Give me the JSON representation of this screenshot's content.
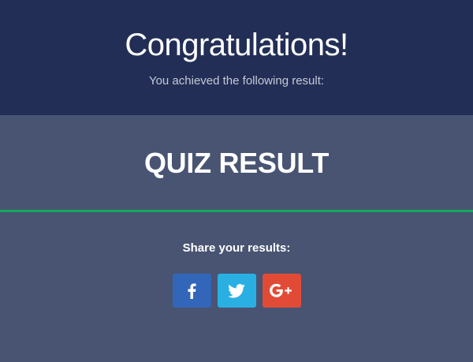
{
  "header": {
    "title": "Congratulations!",
    "subtitle": "You achieved the following result:"
  },
  "result": {
    "title": "QUIZ RESULT"
  },
  "share": {
    "label": "Share your results:",
    "buttons": [
      {
        "network": "facebook",
        "icon": "facebook-icon",
        "color": "#3266b9"
      },
      {
        "network": "twitter",
        "icon": "twitter-icon",
        "color": "#2aafe3"
      },
      {
        "network": "google-plus",
        "icon": "google-plus-icon",
        "color": "#e14b36"
      }
    ]
  },
  "colors": {
    "header_bg": "#222e55",
    "body_bg": "#485472",
    "accent_line": "#16a75c"
  }
}
